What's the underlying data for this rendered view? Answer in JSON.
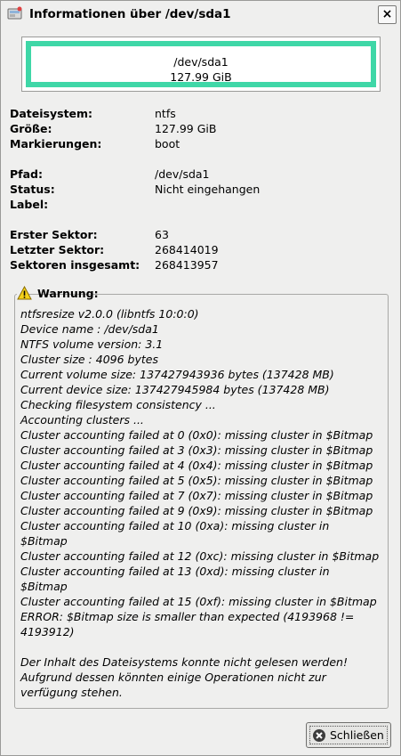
{
  "window": {
    "title": "Informationen über /dev/sda1",
    "close_symbol": "×"
  },
  "graphic": {
    "name": "/dev/sda1",
    "size": "127.99 GiB",
    "color": "#3fd7a7"
  },
  "info": {
    "filesystem": {
      "label": "Dateisystem:",
      "value": "ntfs"
    },
    "size": {
      "label": "Größe:",
      "value": "127.99 GiB"
    },
    "flags": {
      "label": "Markierungen:",
      "value": "boot"
    },
    "path": {
      "label": "Pfad:",
      "value": "/dev/sda1"
    },
    "status": {
      "label": "Status:",
      "value": "Nicht eingehangen"
    },
    "fslabel": {
      "label": "Label:",
      "value": ""
    },
    "first_sector": {
      "label": "Erster Sektor:",
      "value": "63"
    },
    "last_sector": {
      "label": "Letzter Sektor:",
      "value": "268414019"
    },
    "total_sectors": {
      "label": "Sektoren insgesamt:",
      "value": "268413957"
    }
  },
  "warning": {
    "title": "Warnung:",
    "icon": "warning-triangle-icon",
    "lines": [
      "ntfsresize v2.0.0 (libntfs 10:0:0)",
      "Device name        : /dev/sda1",
      "NTFS volume version: 3.1",
      "Cluster size       : 4096 bytes",
      "Current volume size: 137427943936 bytes (137428 MB)",
      "Current device size: 137427945984 bytes (137428 MB)",
      "Checking filesystem consistency ...",
      "Accounting clusters ...",
      "Cluster accounting failed at 0 (0x0): missing cluster in $Bitmap",
      "Cluster accounting failed at 3 (0x3): missing cluster in $Bitmap",
      "Cluster accounting failed at 4 (0x4): missing cluster in $Bitmap",
      "Cluster accounting failed at 5 (0x5): missing cluster in $Bitmap",
      "Cluster accounting failed at 7 (0x7): missing cluster in $Bitmap",
      "Cluster accounting failed at 9 (0x9): missing cluster in $Bitmap",
      "Cluster accounting failed at 10 (0xa): missing cluster in",
      "$Bitmap",
      "Cluster accounting failed at 12 (0xc): missing cluster in $Bitmap",
      "Cluster accounting failed at 13 (0xd): missing cluster in",
      "$Bitmap",
      "Cluster accounting failed at 15 (0xf): missing cluster in $Bitmap",
      "ERROR: $Bitmap size is smaller than expected (4193968 !=",
      "4193912)",
      "",
      "Der Inhalt des Dateisystems konnte nicht gelesen werden!",
      "Aufgrund dessen könnten einige Operationen nicht zur",
      "verfügung stehen."
    ]
  },
  "buttons": {
    "close_label": "Schließen",
    "close_icon": "close-circle-icon"
  }
}
